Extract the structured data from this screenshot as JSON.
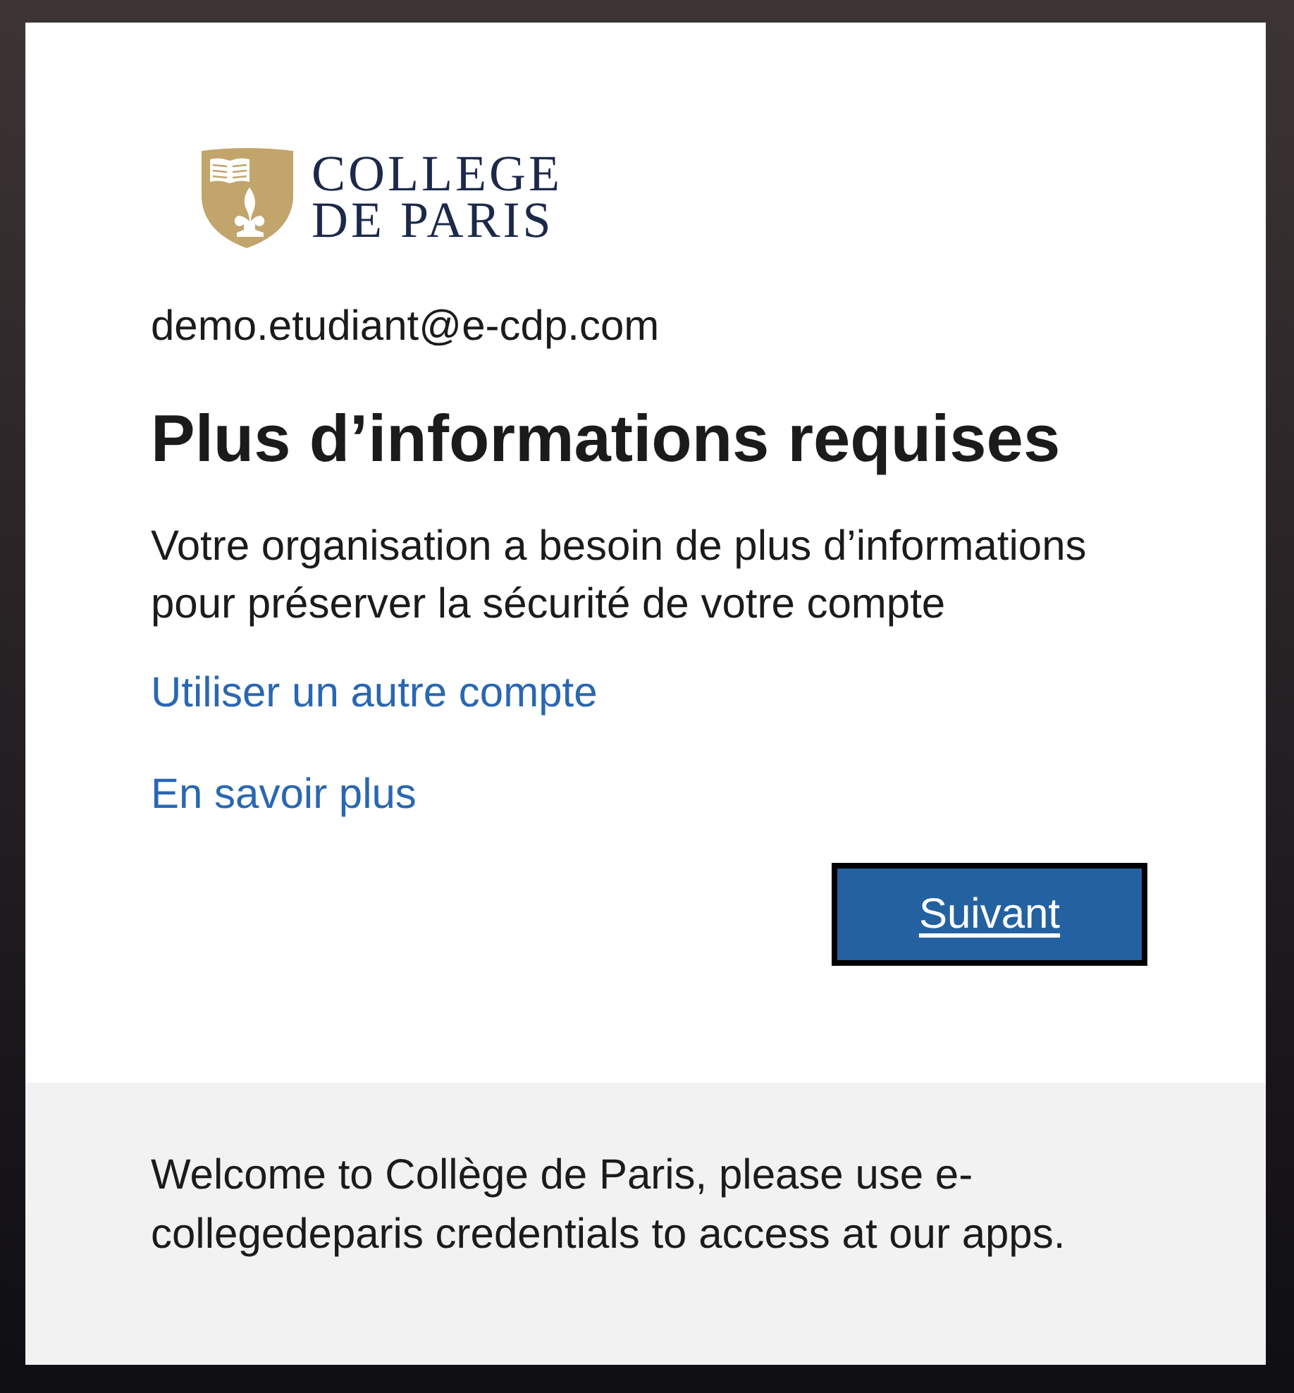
{
  "logo": {
    "lines": [
      "COLLEGE",
      "DE PARIS"
    ]
  },
  "account": {
    "email": "demo.etudiant@e-cdp.com"
  },
  "title": "Plus d’informations requises",
  "message": "Votre organisation a besoin de plus d’informations pour préserver la sécurité de votre compte",
  "links": [
    "Utiliser un autre compte",
    "En savoir plus"
  ],
  "primary_button": {
    "label": "Suivant",
    "focused": true
  },
  "footer": {
    "text": "Welcome to Collège de Paris, please use e-collegedeparis credentials to access at our apps."
  }
}
